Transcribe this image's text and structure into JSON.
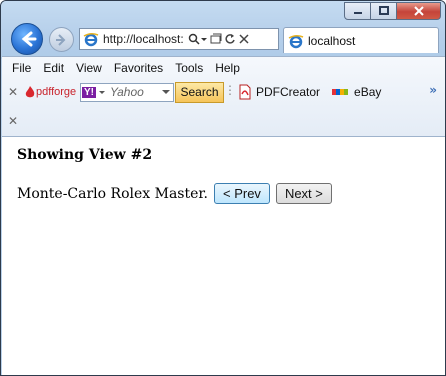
{
  "browser": {
    "address": "http://localhost:",
    "tab_title": "localhost",
    "menu": [
      "File",
      "Edit",
      "View",
      "Favorites",
      "Tools",
      "Help"
    ],
    "toolbar": {
      "pdfforge_label": "pdfforge",
      "search_placeholder": "Yahoo",
      "search_button": "Search",
      "pdfcreator_label": "PDFCreator",
      "ebay_label": "eBay"
    }
  },
  "page": {
    "heading": "Showing View #2",
    "text": "Monte-Carlo Rolex Master.",
    "prev_label": "< Prev",
    "next_label": "Next >"
  }
}
